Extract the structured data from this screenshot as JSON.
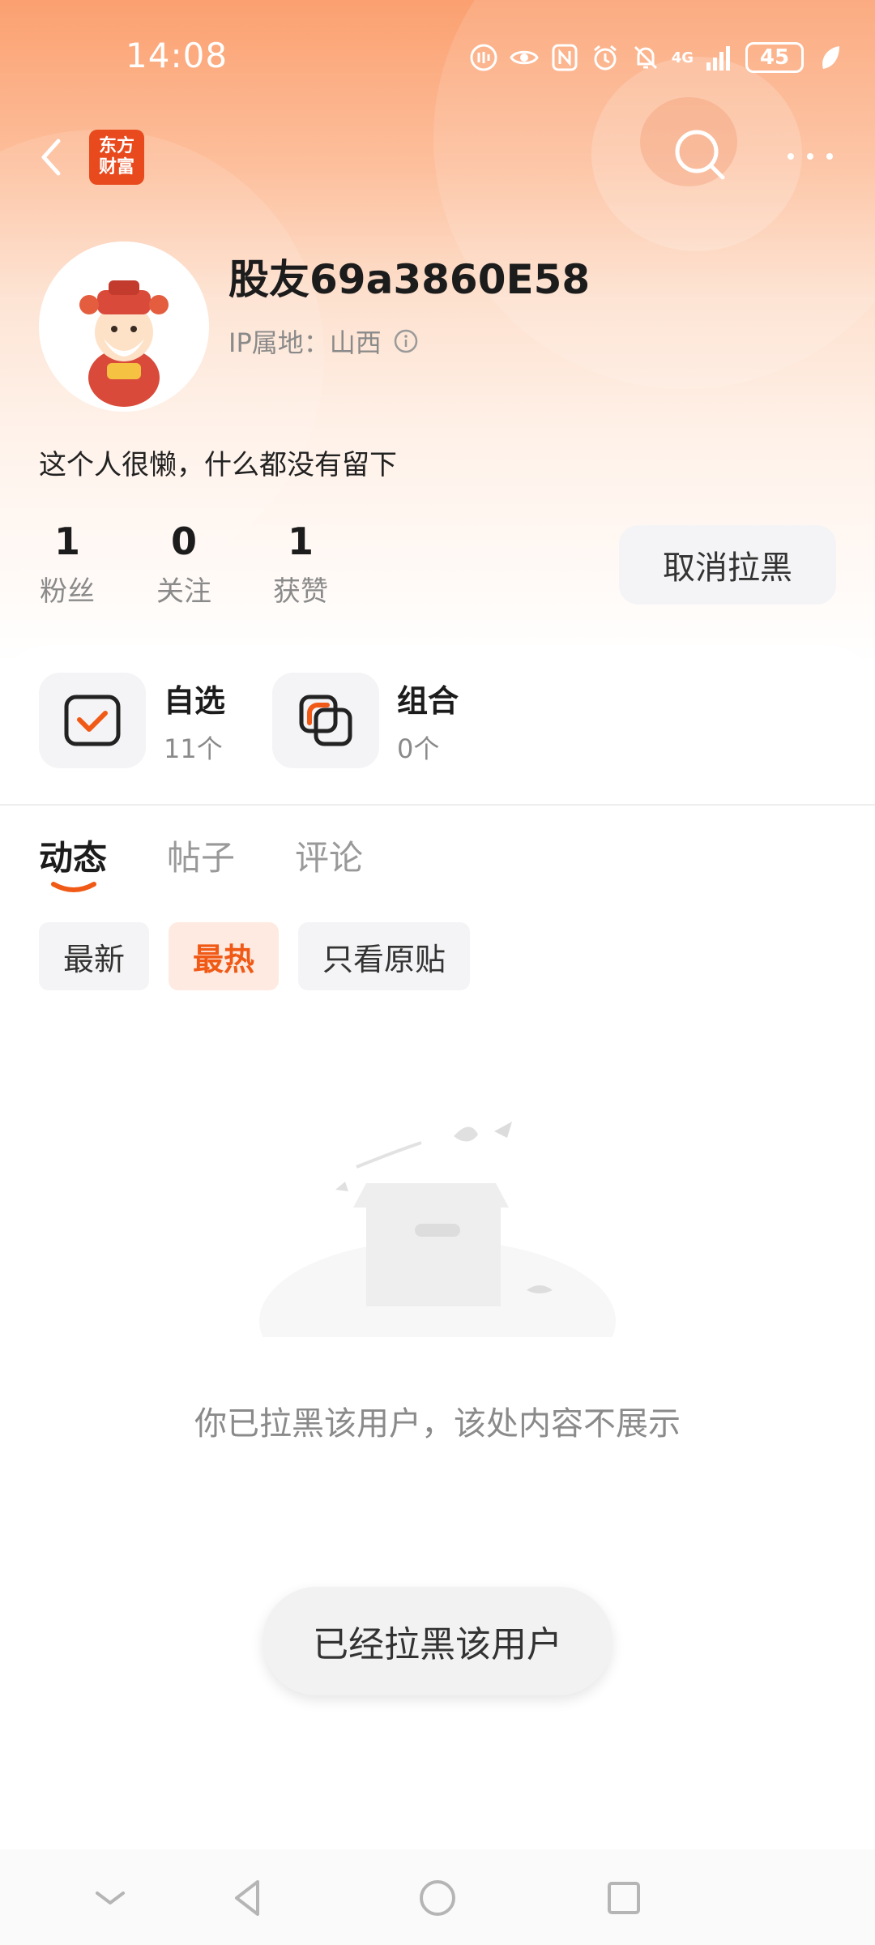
{
  "status_bar": {
    "time": "14:08",
    "network": "4G",
    "battery": "45"
  },
  "header": {
    "logo_line1": "东方",
    "logo_line2": "财富"
  },
  "profile": {
    "username": "股友69a3860E58",
    "ip_label": "IP属地：",
    "ip_location": "山西",
    "bio": "这个人很懒，什么都没有留下"
  },
  "stats": [
    {
      "value": "1",
      "label": "粉丝"
    },
    {
      "value": "0",
      "label": "关注"
    },
    {
      "value": "1",
      "label": "获赞"
    }
  ],
  "unblock_button": "取消拉黑",
  "portfolio": [
    {
      "title": "自选",
      "count": "11个",
      "icon": "checkbox-icon"
    },
    {
      "title": "组合",
      "count": "0个",
      "icon": "overlap-squares-icon"
    }
  ],
  "tabs": [
    {
      "label": "动态",
      "active": true
    },
    {
      "label": "帖子",
      "active": false
    },
    {
      "label": "评论",
      "active": false
    }
  ],
  "filters": [
    {
      "label": "最新",
      "active": false
    },
    {
      "label": "最热",
      "active": true
    },
    {
      "label": "只看原贴",
      "active": false
    }
  ],
  "empty_message": "你已拉黑该用户，该处内容不展示",
  "toast": "已经拉黑该用户",
  "colors": {
    "accent": "#f05a16",
    "brand": "#e8491d",
    "header_gradient_top": "#fba070"
  }
}
